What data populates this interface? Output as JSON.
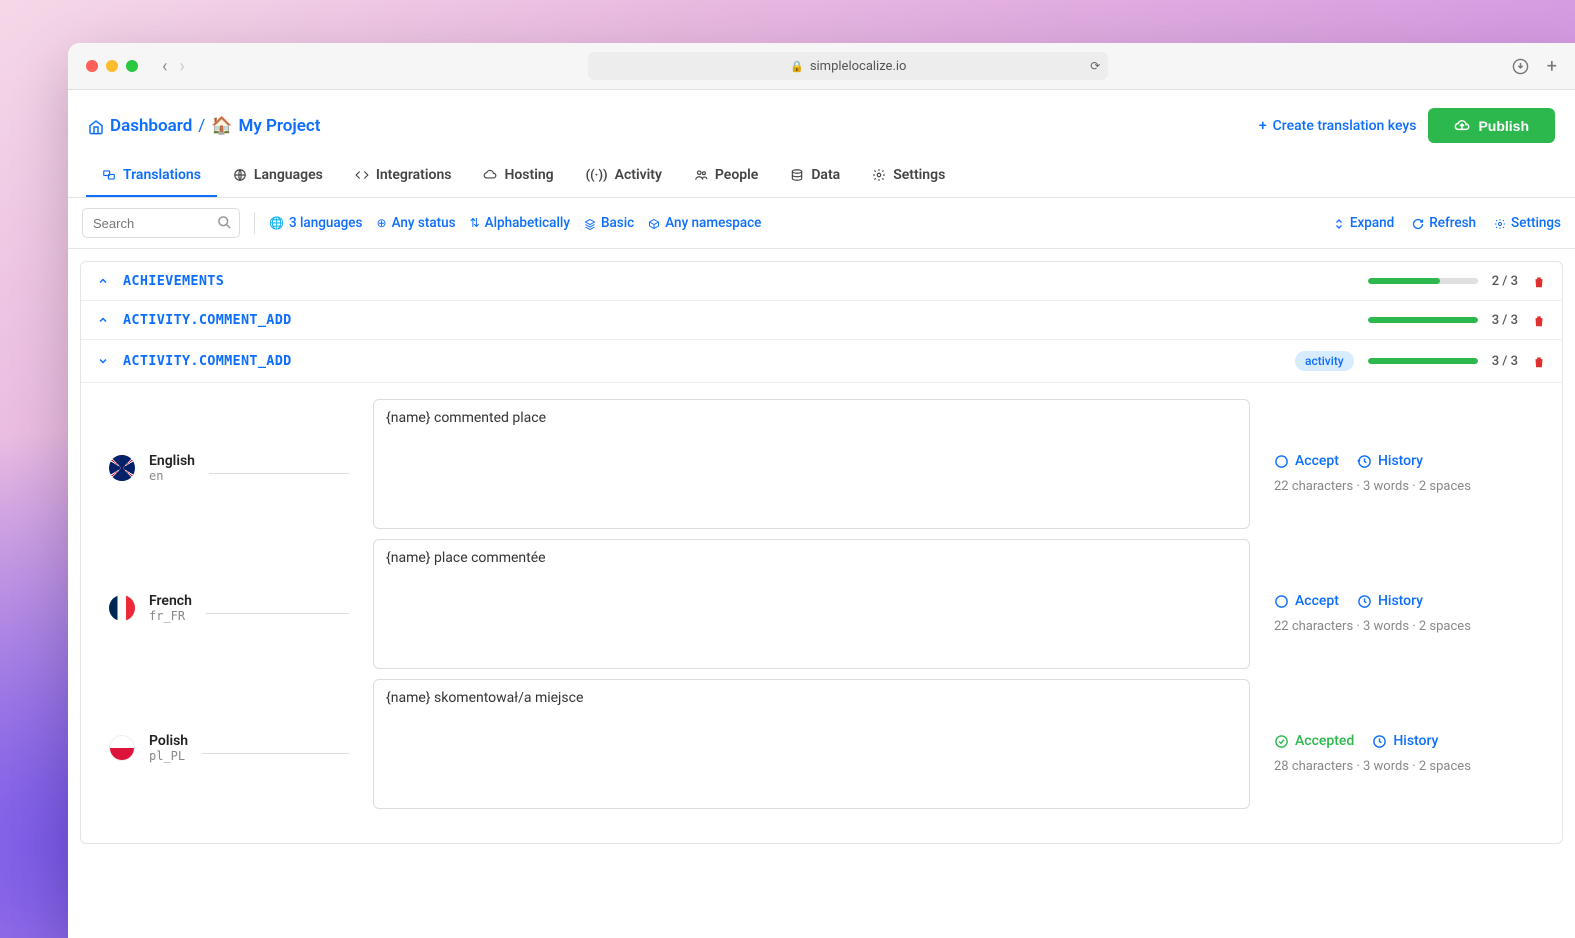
{
  "browser": {
    "url": "simplelocalize.io"
  },
  "breadcrumb": {
    "dashboard": "Dashboard",
    "separator": "/",
    "project_emoji": "🏠",
    "project": "My Project"
  },
  "header_actions": {
    "create_keys": "Create translation keys",
    "publish": "Publish"
  },
  "tabs": [
    {
      "label": "Translations",
      "icon": "translate"
    },
    {
      "label": "Languages",
      "icon": "globe"
    },
    {
      "label": "Integrations",
      "icon": "code"
    },
    {
      "label": "Hosting",
      "icon": "cloud"
    },
    {
      "label": "Activity",
      "icon": "signal"
    },
    {
      "label": "People",
      "icon": "people"
    },
    {
      "label": "Data",
      "icon": "database"
    },
    {
      "label": "Settings",
      "icon": "gear"
    }
  ],
  "search": {
    "placeholder": "Search"
  },
  "filters": {
    "languages": "3 languages",
    "status": "Any status",
    "sort": "Alphabetically",
    "view": "Basic",
    "namespace": "Any namespace"
  },
  "right_actions": {
    "expand": "Expand",
    "refresh": "Refresh",
    "settings": "Settings"
  },
  "keys": [
    {
      "name": "ACHIEVEMENTS",
      "expanded": false,
      "progress": "2 / 3",
      "progress_pct": 66,
      "badge": null
    },
    {
      "name": "ACTIVITY.COMMENT_ADD",
      "expanded": false,
      "progress": "3 / 3",
      "progress_pct": 100,
      "badge": null
    },
    {
      "name": "ACTIVITY.COMMENT_ADD",
      "expanded": true,
      "progress": "3 / 3",
      "progress_pct": 100,
      "badge": "activity"
    }
  ],
  "translations": [
    {
      "lang_name": "English",
      "lang_code": "en",
      "flag": "uk",
      "value": "{name} commented place",
      "accepted": false,
      "accept_label": "Accept",
      "history_label": "History",
      "stats": "22 characters  ·  3 words  ·  2 spaces"
    },
    {
      "lang_name": "French",
      "lang_code": "fr_FR",
      "flag": "fr",
      "value": "{name} place commentée",
      "accepted": false,
      "accept_label": "Accept",
      "history_label": "History",
      "stats": "22 characters  ·  3 words  ·  2 spaces"
    },
    {
      "lang_name": "Polish",
      "lang_code": "pl_PL",
      "flag": "pl",
      "value": "{name} skomentował/a miejsce",
      "accepted": true,
      "accept_label": "Accepted",
      "history_label": "History",
      "stats": "28 characters  ·  3 words  ·  2 spaces"
    }
  ]
}
